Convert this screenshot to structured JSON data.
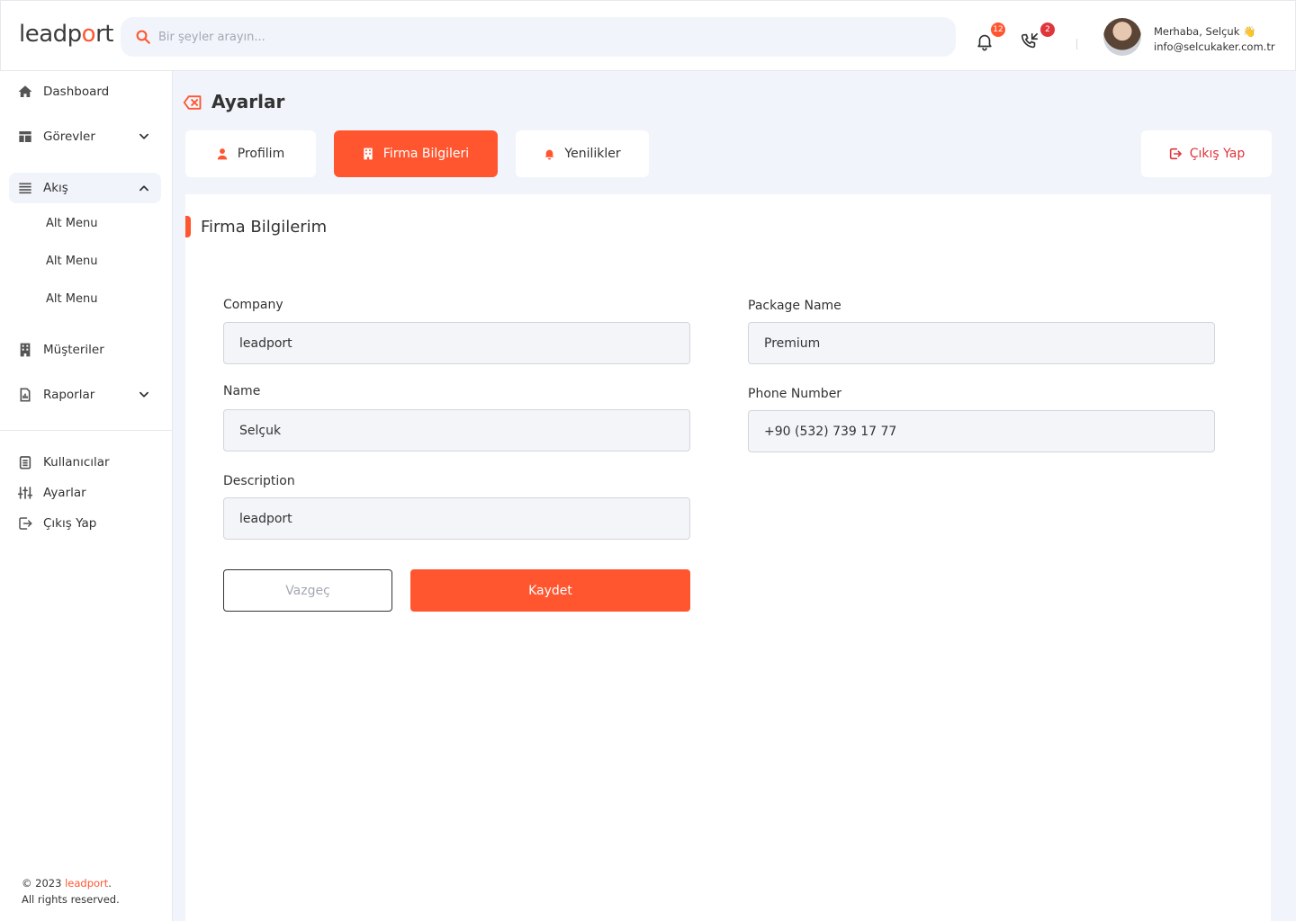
{
  "brand": {
    "logo_part1": "leadp",
    "logo_o": "o",
    "logo_part2": "rt",
    "accent_color": "#ff5630"
  },
  "header": {
    "search_placeholder": "Bir şeyler arayın...",
    "notifications_count": "12",
    "calls_count": "2",
    "greeting": "Merhaba, Selçuk 👋",
    "email": "info@selcukaker.com.tr"
  },
  "sidebar": {
    "items": [
      {
        "label": "Dashboard",
        "icon": "home-icon"
      },
      {
        "label": "Görevler",
        "icon": "layout-icon"
      },
      {
        "label": "Akış",
        "icon": "menu-icon"
      },
      {
        "label": "Müşteriler",
        "icon": "building-icon"
      },
      {
        "label": "Raporlar",
        "icon": "report-icon"
      }
    ],
    "sub_items": [
      "Alt Menu",
      "Alt Menu",
      "Alt Menu"
    ],
    "bottom_items": [
      {
        "label": "Kullanıcılar",
        "icon": "clipboard-icon"
      },
      {
        "label": "Ayarlar",
        "icon": "sliders-icon"
      },
      {
        "label": "Çıkış Yap",
        "icon": "logout-icon"
      }
    ],
    "footer_copyright": "© 2023 ",
    "footer_brand": "leadport",
    "footer_dot": ".",
    "footer_rights": "All rights reserved."
  },
  "page": {
    "title": "Ayarlar",
    "tabs": [
      {
        "label": "Profilim"
      },
      {
        "label": "Firma Bilgileri"
      },
      {
        "label": "Yenilikler"
      }
    ],
    "logout_label": "Çıkış Yap"
  },
  "form": {
    "section_title": "Firma Bilgilerim",
    "company_label": "Company",
    "company_value": "leadport",
    "name_label": "Name",
    "name_value": "Selçuk",
    "description_label": "Description",
    "description_value": "leadport",
    "package_label": "Package Name",
    "package_value": "Premium",
    "phone_label": "Phone Number",
    "phone_value": "+90 (532) 739 17 77",
    "cancel_label": "Vazgeç",
    "save_label": "Kaydet"
  }
}
